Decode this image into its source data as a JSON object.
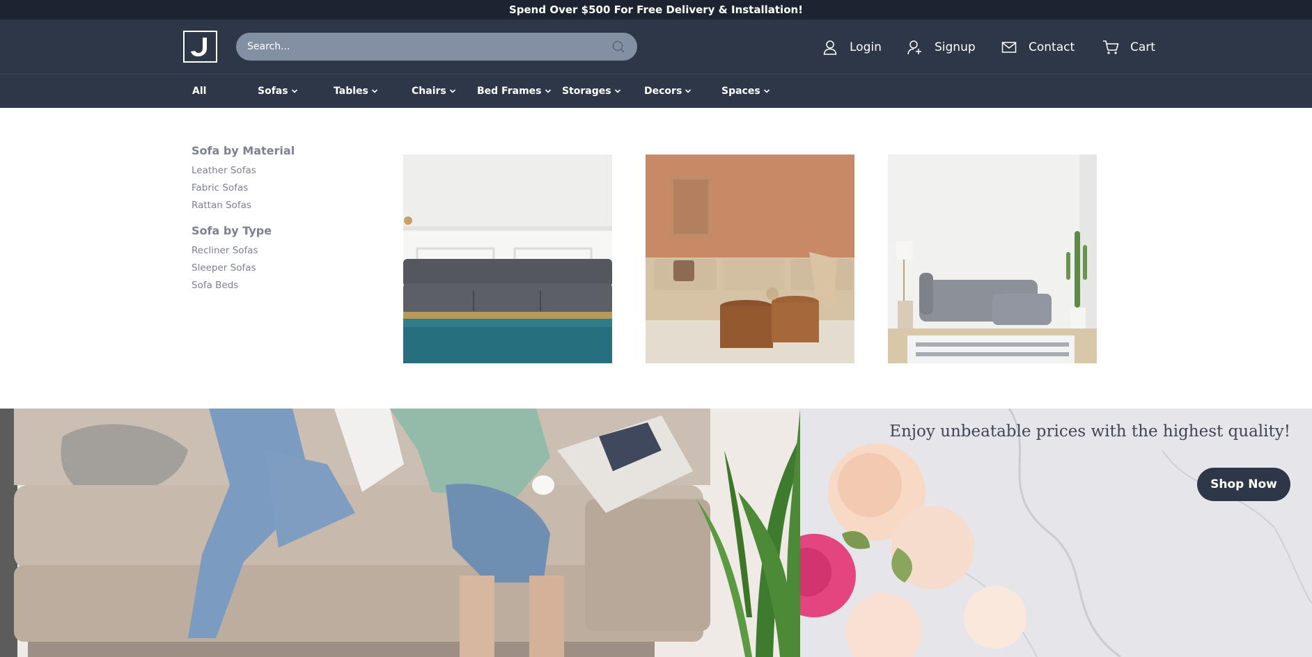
{
  "promo": {
    "text": "Spend Over $500 For Free Delivery & Installation!"
  },
  "header": {
    "logo_icon": "brand-logo-icon",
    "search": {
      "placeholder": "Search..."
    },
    "nav": [
      {
        "label": "Login",
        "icon": "user-icon"
      },
      {
        "label": "Signup",
        "icon": "user-plus-icon"
      },
      {
        "label": "Contact",
        "icon": "mail-icon"
      },
      {
        "label": "Cart",
        "icon": "cart-icon"
      }
    ]
  },
  "categories": [
    {
      "label": "All"
    },
    {
      "label": "Sofas"
    },
    {
      "label": "Tables"
    },
    {
      "label": "Chairs"
    },
    {
      "label": "Bed Frames"
    },
    {
      "label": "Storages"
    },
    {
      "label": "Decors"
    },
    {
      "label": "Spaces"
    }
  ],
  "mega_menu": {
    "groups": [
      {
        "title": "Sofa by Material",
        "links": [
          "Leather Sofas",
          "Fabric Sofas",
          "Rattan Sofas"
        ]
      },
      {
        "title": "Sofa by Type",
        "links": [
          "Recliner Sofas",
          "Sleeper Sofas",
          "Sofa Beds"
        ]
      }
    ],
    "images": [
      "grey-velvet-sofa-image",
      "beige-sofa-terracotta-wall-image",
      "grey-sectional-sofa-image"
    ]
  },
  "hero": {
    "tagline": "Enjoy unbeatable prices with the highest quality!",
    "cta_label": "Shop Now"
  },
  "colors": {
    "promo_bg": "#1c2331",
    "header_bg": "#2e3748",
    "search_bg": "#8390a4",
    "muted_text": "#7a8191"
  }
}
